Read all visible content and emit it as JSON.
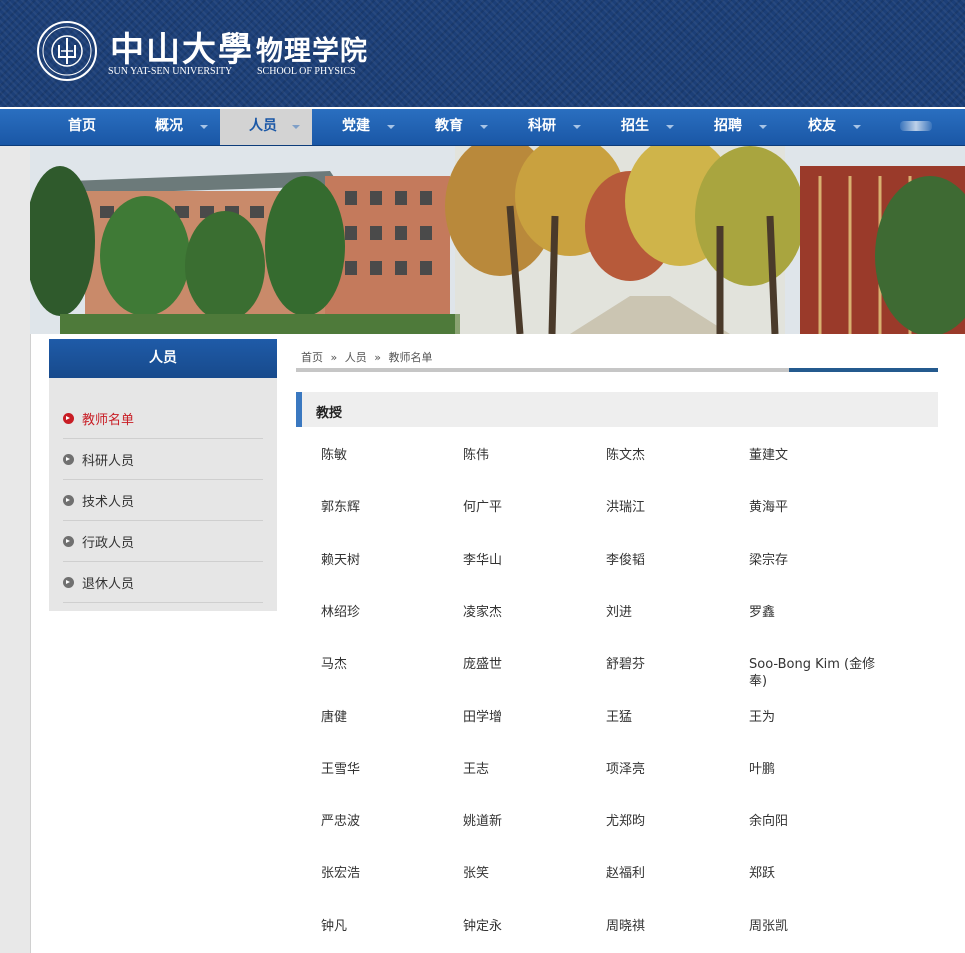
{
  "header": {
    "university_cn": "中山大學",
    "school_cn": "物理学院",
    "university_en": "SUN YAT-SEN UNIVERSITY",
    "school_en": "SCHOOL OF PHYSICS",
    "background_color": "#1c3f78"
  },
  "nav": {
    "items": [
      {
        "label": "首页",
        "has_dropdown": false,
        "active": false
      },
      {
        "label": "概况",
        "has_dropdown": true,
        "active": false
      },
      {
        "label": "人员",
        "has_dropdown": true,
        "active": true
      },
      {
        "label": "党建",
        "has_dropdown": true,
        "active": false
      },
      {
        "label": "教育",
        "has_dropdown": true,
        "active": false
      },
      {
        "label": "科研",
        "has_dropdown": true,
        "active": false
      },
      {
        "label": "招生",
        "has_dropdown": true,
        "active": false
      },
      {
        "label": "招聘",
        "has_dropdown": true,
        "active": false
      },
      {
        "label": "校友",
        "has_dropdown": true,
        "active": false
      }
    ],
    "accent_color": "#1a57a6"
  },
  "sidebar": {
    "title": "人员",
    "items": [
      {
        "label": "教师名单",
        "active": true
      },
      {
        "label": "科研人员",
        "active": false
      },
      {
        "label": "技术人员",
        "active": false
      },
      {
        "label": "行政人员",
        "active": false
      },
      {
        "label": "退休人员",
        "active": false
      }
    ],
    "active_color": "#c81d25"
  },
  "breadcrumb": {
    "home": "首页",
    "sep1": "»",
    "level1": "人员",
    "sep2": "»",
    "current": "教师名单"
  },
  "section": {
    "title": "教授",
    "people": [
      "陈敏",
      "陈伟",
      "陈文杰",
      "董建文",
      "郭东辉",
      "何广平",
      "洪瑞江",
      "黄海平",
      "赖天树",
      "李华山",
      "李俊韬",
      "梁宗存",
      "林绍珍",
      "凌家杰",
      "刘进",
      "罗鑫",
      "马杰",
      "庞盛世",
      "舒碧芬",
      "Soo-Bong Kim (金修奉)",
      "唐健",
      "田学增",
      "王猛",
      "王为",
      "王雪华",
      "王志",
      "项泽亮",
      "叶鹏",
      "严忠波",
      "姚道新",
      "尤郑昀",
      "余向阳",
      "张宏浩",
      "张笑",
      "赵福利",
      "郑跃",
      "钟凡",
      "钟定永",
      "周晓祺",
      "周张凯"
    ]
  }
}
